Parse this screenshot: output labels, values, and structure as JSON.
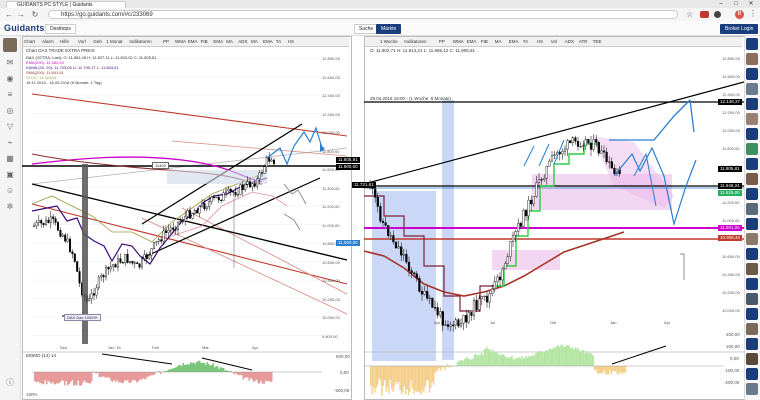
{
  "browser": {
    "tab_title": "GUIDANTS PC STYLE | Guidants",
    "url": "https://go.guidants.com/#c/233069",
    "window_controls": [
      "–",
      "□",
      "✕"
    ],
    "profile_initial": "B"
  },
  "app": {
    "logo": "Guidants",
    "desktop_label": "Desktops",
    "search_label": "Suche",
    "markets_label": "Märkte",
    "broker_label": "Broker Login"
  },
  "left_panel": {
    "toolbar": [
      "Chart",
      "Alarm",
      "Hilfe",
      "Vorl",
      "Geh",
      "1 Monat",
      "Indikatoren",
      "PP",
      "WMA",
      "EMA",
      "FIB",
      "EMA",
      "MA",
      "ADX",
      "MA",
      "EMA",
      "TA",
      "HS"
    ],
    "title": "Chart DAX TRADE EXTRA PREIS",
    "info_lines": [
      "DAX (XETRA, Last): O: 11.884,48  H: 11.827,11  L: 11.803,02  C: 11.805,81",
      "EMA(200): 11.582,93",
      "KAMA (20, 20): 11.703,05  U: 11.799,17  L: 11.563,41",
      "SMA(200): 11.841,91",
      "STOC: 11.323,01",
      "16.11.2015 - 16.05.2016 (6 Monate, 1 Tag)"
    ],
    "y_ticks": [
      "12.800,00",
      "12.600,00",
      "12.400,00",
      "12.200,00",
      "12.000,00",
      "11.800,00",
      "11.600,00",
      "11.400,00",
      "11.200,00",
      "11.000,00",
      "10.800,00",
      "10.600,00",
      "10.400,00",
      "10.200,00",
      "10.000,00",
      "9.800,00"
    ],
    "x_ticks": [
      "Dez",
      "Jan '16",
      "Feb",
      "Mär",
      "Apr"
    ],
    "label_box": "11400",
    "price_tag_top": "11.805,81",
    "price_tag_mid": "11.800,00",
    "price_tag_blue": "11.000,00",
    "low_label": "DAX Dax 10529+",
    "indicator_title": "MOMO (14) 14",
    "indicator_ticks": [
      "500,00",
      "0,00",
      "-500,00"
    ],
    "zoom": "100%"
  },
  "right_panel": {
    "toolbar": [
      "1 Woche",
      "Indikatoren",
      "PP",
      "WMA",
      "EMA",
      "FIB",
      "MA",
      "EMA",
      "TA",
      "HS",
      "Vol",
      "ADX",
      "ATR",
      "TEE"
    ],
    "ohlc": "O: 11.802,71  H: 11.814,21  L: 11.666,12  C: 11.805,81",
    "title": "Chart DAX TRADE EXTRA PREIS",
    "date_line": "29.04.2016 16:00 - (1 Woche, 5 Monate)",
    "y_ticks": [
      "12.800,00",
      "12.600,00",
      "12.400,00",
      "12.200,00",
      "12.000,00",
      "11.800,00",
      "11.600,00",
      "11.400,00",
      "11.200,00",
      "11.000,00",
      "10.800,00",
      "10.600,00",
      "10.400,00",
      "10.200,00",
      "10.000,00"
    ],
    "x_ticks": [
      "Apr",
      "Jul",
      "Okt",
      "Jan",
      "Apr"
    ],
    "tag_black_top": "12.148,37",
    "tag_blue_1": "11.805,81",
    "tag_black_2": "11.646,24",
    "tag_green": "11.525,00",
    "tag_magenta": "11.001,00",
    "tag_red": "10.908,40",
    "indicator_ticks": [
      "200,00",
      "100,00",
      "0,00",
      "-100,00",
      "-200,00"
    ],
    "left_label": "11.721,61"
  },
  "colors": {
    "accent": "#1a3d7c",
    "candle_black": "#000000",
    "trend_red": "#c0392b",
    "magenta": "#cc00cc",
    "blue_arrow": "#2a7fcf",
    "green": "#2ecc40",
    "pink_zone": "#e8b4e8",
    "blue_zone": "#9fb6f0"
  }
}
